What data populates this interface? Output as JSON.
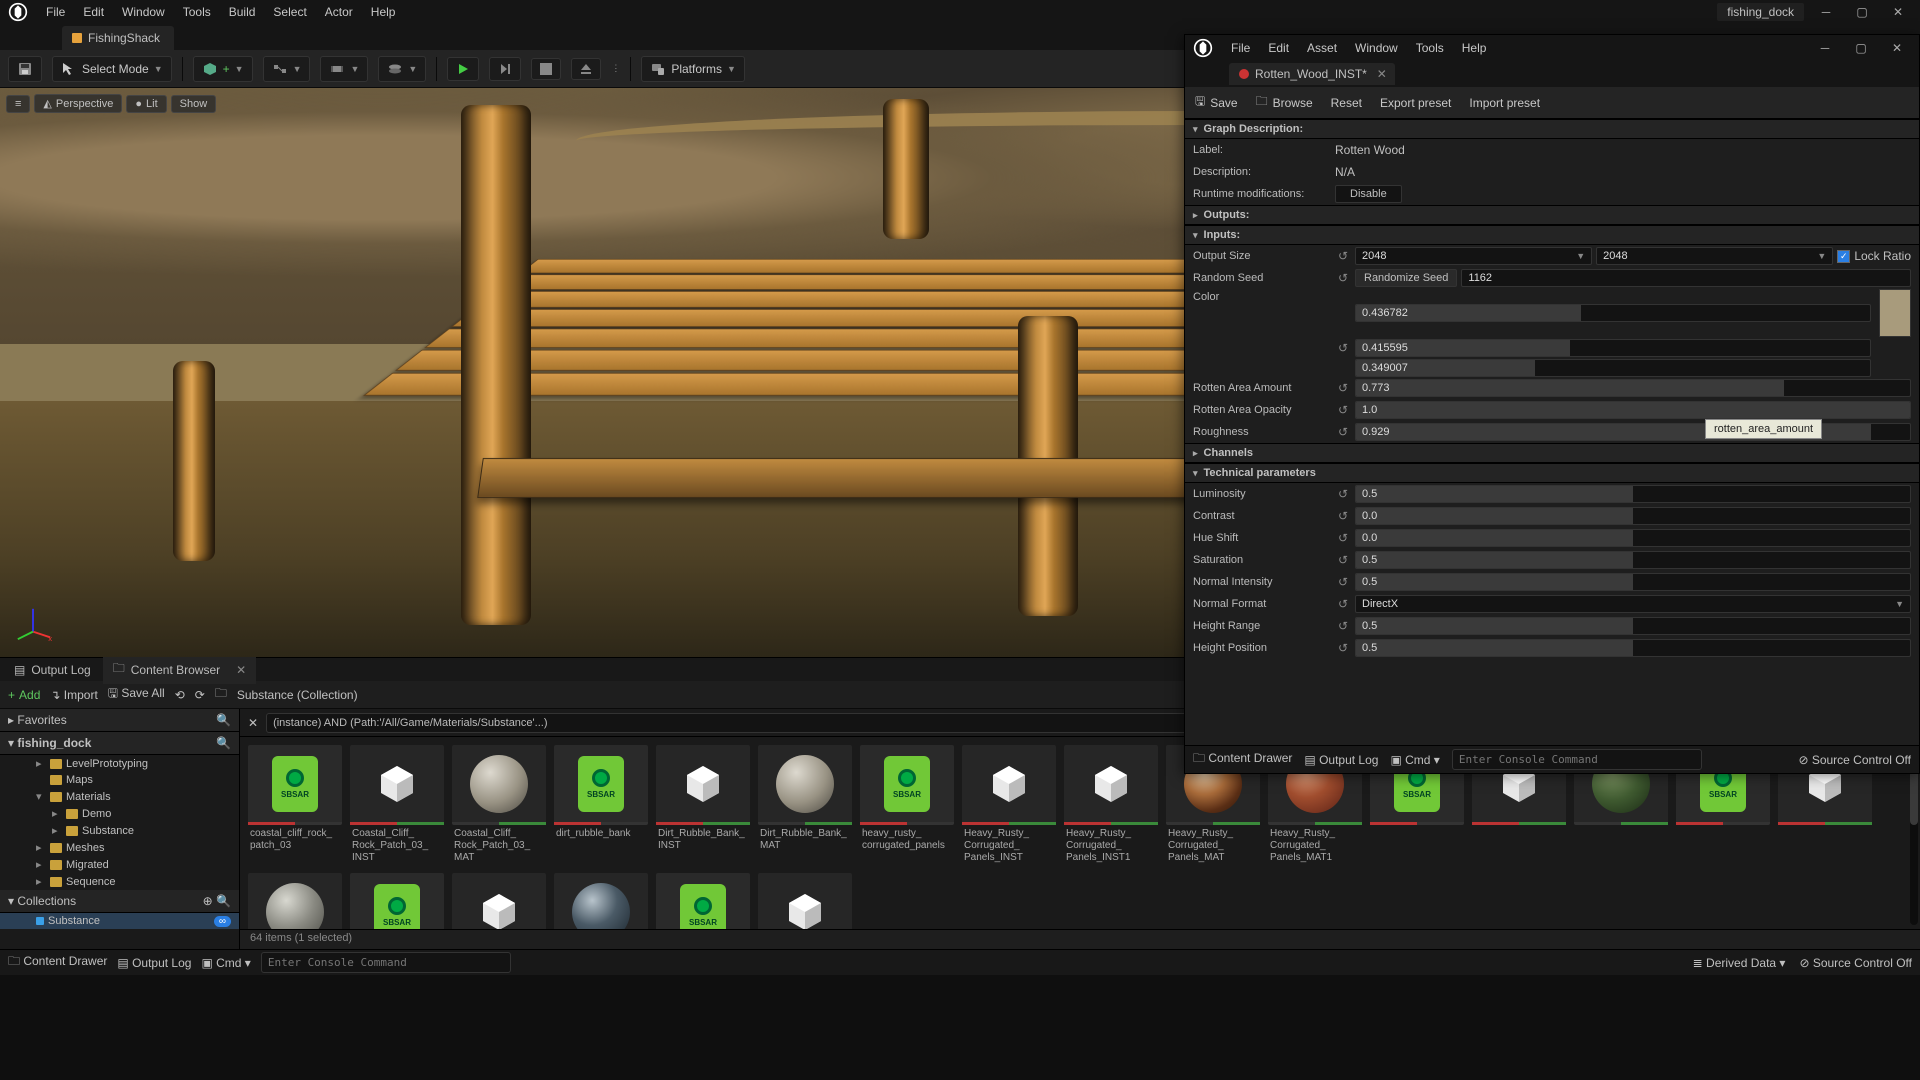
{
  "project_name": "fishing_dock",
  "main_tab": "FishingShack",
  "menu": [
    "File",
    "Edit",
    "Window",
    "Tools",
    "Build",
    "Select",
    "Actor",
    "Help"
  ],
  "toolbar": {
    "mode": "Select Mode",
    "platforms": "Platforms"
  },
  "viewport": {
    "view": "Perspective",
    "lit": "Lit",
    "show": "Show"
  },
  "bottom_tabs": {
    "output_log": "Output Log",
    "content_browser": "Content Browser"
  },
  "cb_toolbar": {
    "add": "Add",
    "import": "Import",
    "save_all": "Save All",
    "path": "Substance (Collection)"
  },
  "cb_filter": "(instance) AND (Path:'/All/Game/Materials/Substance'...)",
  "cb_status": "64 items (1 selected)",
  "tree": {
    "favorites": "Favorites",
    "root": "fishing_dock",
    "items": [
      "LevelPrototyping",
      "Maps",
      "Materials",
      "Demo",
      "Substance",
      "Meshes",
      "Migrated",
      "Sequence"
    ],
    "collections": "Collections",
    "coll_item": "Substance"
  },
  "assets": [
    {
      "name": "coastal_cliff_rock_patch_03",
      "type": "sbsar"
    },
    {
      "name": "Coastal_Cliff_Rock_Patch_03_INST",
      "type": "hex"
    },
    {
      "name": "Coastal_Cliff_Rock_Patch_03_MAT",
      "type": "sphere"
    },
    {
      "name": "dirt_rubble_bank",
      "type": "sbsar"
    },
    {
      "name": "Dirt_Rubble_Bank_INST",
      "type": "hex"
    },
    {
      "name": "Dirt_Rubble_Bank_MAT",
      "type": "sphere"
    },
    {
      "name": "heavy_rusty_corrugated_panels",
      "type": "sbsar"
    },
    {
      "name": "Heavy_Rusty_Corrugated_Panels_INST",
      "type": "hex"
    },
    {
      "name": "Heavy_Rusty_Corrugated_Panels_INST1",
      "type": "hex"
    },
    {
      "name": "Heavy_Rusty_Corrugated_Panels_MAT",
      "type": "rust"
    },
    {
      "name": "Heavy_Rusty_Corrugated_Panels_MAT1",
      "type": "rust2"
    },
    {
      "name": "",
      "type": "sbsar"
    },
    {
      "name": "",
      "type": "hex"
    },
    {
      "name": "",
      "type": "moss"
    },
    {
      "name": "",
      "type": "sbsar"
    },
    {
      "name": "",
      "type": "hex"
    },
    {
      "name": "",
      "type": "gravel"
    },
    {
      "name": "",
      "type": "sbsar"
    },
    {
      "name": "",
      "type": "hex"
    },
    {
      "name": "",
      "type": "metal"
    },
    {
      "name": "",
      "type": "sbsar"
    },
    {
      "name": "",
      "type": "hex"
    }
  ],
  "statusbar": {
    "content_drawer": "Content Drawer",
    "output_log": "Output Log",
    "cmd": "Cmd",
    "cmd_placeholder": "Enter Console Command",
    "derived": "Derived Data",
    "source_ctrl": "Source Control Off"
  },
  "sub": {
    "menu": [
      "File",
      "Edit",
      "Asset",
      "Window",
      "Tools",
      "Help"
    ],
    "tab": "Rotten_Wood_INST*",
    "toolbar": {
      "save": "Save",
      "browse": "Browse",
      "reset": "Reset",
      "export": "Export preset",
      "import": "Import preset"
    },
    "sections": {
      "graph": "Graph Description:",
      "outputs": "Outputs:",
      "inputs": "Inputs:",
      "channels": "Channels",
      "tech": "Technical parameters"
    },
    "graph": {
      "label_k": "Label:",
      "label_v": "Rotten Wood",
      "desc_k": "Description:",
      "desc_v": "N/A",
      "runtime_k": "Runtime modifications:",
      "runtime_v": "Disable"
    },
    "inputs": {
      "output_size": "Output Size",
      "size_w": "2048",
      "size_h": "2048",
      "lock_ratio": "Lock Ratio",
      "random_seed": "Random Seed",
      "randomize": "Randomize Seed",
      "seed_val": "1162",
      "color": "Color",
      "color_r": "0.436782",
      "color_g": "0.415595",
      "color_b": "0.349007",
      "rotten_amount_k": "Rotten Area Amount",
      "rotten_amount_v": "0.773",
      "rotten_opacity_k": "Rotten Area Opacity",
      "rotten_opacity_v": "1.0",
      "roughness_k": "Roughness",
      "roughness_v": "0.929"
    },
    "tech": {
      "luminosity_k": "Luminosity",
      "luminosity_v": "0.5",
      "contrast_k": "Contrast",
      "contrast_v": "0.0",
      "hue_k": "Hue Shift",
      "hue_v": "0.0",
      "saturation_k": "Saturation",
      "saturation_v": "0.5",
      "normal_int_k": "Normal Intensity",
      "normal_int_v": "0.5",
      "normal_fmt_k": "Normal Format",
      "normal_fmt_v": "DirectX",
      "height_range_k": "Height Range",
      "height_range_v": "0.5",
      "height_pos_k": "Height Position",
      "height_pos_v": "0.5"
    },
    "tooltip": "rotten_area_amount",
    "status": {
      "content_drawer": "Content Drawer",
      "output_log": "Output Log",
      "cmd": "Cmd",
      "cmd_placeholder": "Enter Console Command",
      "source_ctrl": "Source Control Off"
    }
  }
}
